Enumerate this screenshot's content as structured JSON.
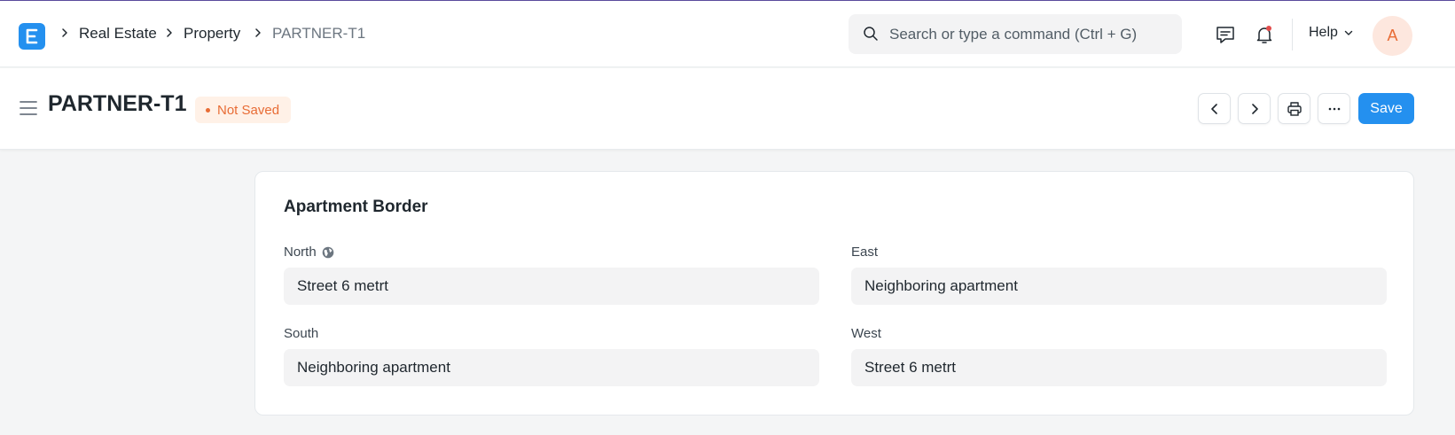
{
  "breadcrumbs": [
    {
      "label": "Real Estate"
    },
    {
      "label": "Property"
    },
    {
      "label": "PARTNER-T1"
    }
  ],
  "search": {
    "placeholder": "Search or type a command (Ctrl + G)"
  },
  "navbar": {
    "help_label": "Help",
    "avatar_initial": "A"
  },
  "page": {
    "title": "PARTNER-T1",
    "status": "Not Saved",
    "save_label": "Save"
  },
  "section": {
    "title": "Apartment Border",
    "fields": {
      "north": {
        "label": "North",
        "value": "Street 6 metrt"
      },
      "east": {
        "label": "East",
        "value": "Neighboring apartment"
      },
      "south": {
        "label": "South",
        "value": "Neighboring apartment"
      },
      "west": {
        "label": "West",
        "value": "Street 6 metrt"
      }
    }
  },
  "colors": {
    "accent": "#2490ef",
    "status_orange": "#e86c35",
    "status_bg": "#fff1e7"
  },
  "icons": [
    "app-logo",
    "chevron-right-icon",
    "search-icon",
    "chat-icon",
    "bell-icon",
    "chevron-down-icon",
    "hamburger-icon",
    "chevron-left-icon",
    "printer-icon",
    "more-icon",
    "globe-icon"
  ]
}
